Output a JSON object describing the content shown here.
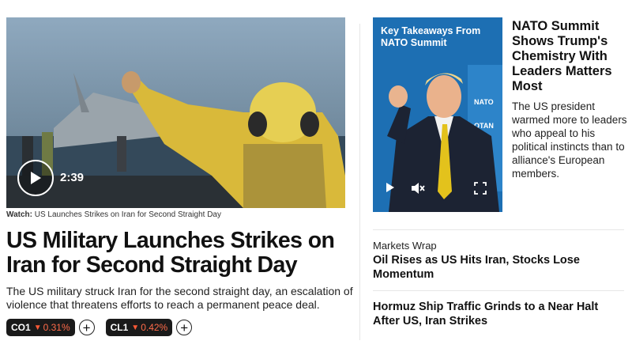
{
  "lead": {
    "video_duration": "2:39",
    "caption_label": "Watch:",
    "caption_text": " US Launches Strikes on Iran for Second Straight Day",
    "headline": "US Military Launches Strikes on Iran for Second Straight Day",
    "summary": "The US military struck Iran for the second straight day, an escalation of violence that threatens efforts to reach a permanent peace deal.",
    "tickers": [
      {
        "symbol": "CO1",
        "change": "0.31%"
      },
      {
        "symbol": "CL1",
        "change": "0.42%"
      }
    ]
  },
  "nato": {
    "video_title": "Key Takeaways From NATO Summit",
    "headline": "NATO Summit Shows Trump's Chemistry With Leaders Matters Most",
    "summary": "The US president warmed more to leaders who appeal to his political instincts than to alliance's European members."
  },
  "markets": {
    "kicker": "Markets Wrap",
    "headline": "Oil Rises as US Hits Iran, Stocks Lose Momentum"
  },
  "hormuz": {
    "headline": "Hormuz Ship Traffic Grinds to a Near Halt After US, Iran Strikes"
  },
  "colors": {
    "negative": "#ff5a36",
    "ticker_bg": "#1a1a1a",
    "nato_blue": "#1d6fb3",
    "jacket_yellow": "#d9b93a"
  }
}
